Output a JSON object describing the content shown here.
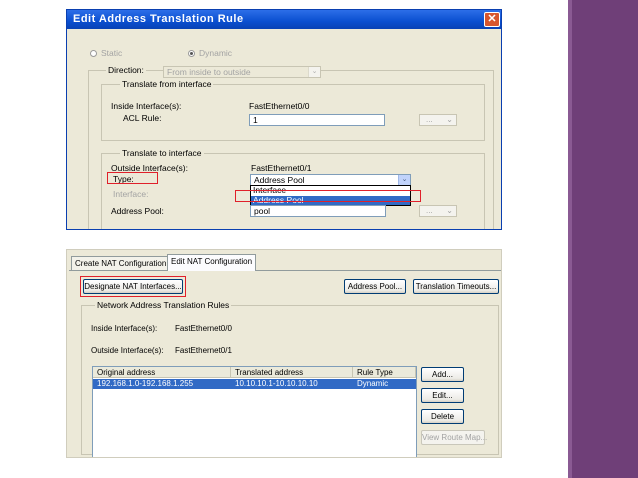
{
  "top_dialog": {
    "title": "Edit Address Translation Rule",
    "close_glyph": "✕",
    "mode": {
      "static_label": "Static",
      "dynamic_label": "Dynamic",
      "selected": "Dynamic"
    },
    "direction": {
      "label": "Direction:",
      "value": "From inside to outside"
    },
    "translate_from": {
      "legend": "Translate from interface",
      "inside_label": "Inside Interface(s):",
      "inside_value": "FastEthernet0/0",
      "acl_label": "ACL Rule:",
      "acl_value": "1",
      "acl_button": "..."
    },
    "translate_to": {
      "legend": "Translate to interface",
      "outside_label": "Outside Interface(s):",
      "outside_value": "FastEthernet0/1",
      "type_label": "Type:",
      "type_value": "Address Pool",
      "type_options": [
        "Interface",
        "Address Pool"
      ],
      "interface_label": "Interface:",
      "pool_label": "Address Pool:",
      "pool_value": "pool",
      "pool_button": "..."
    }
  },
  "bottom_window": {
    "tabs": [
      {
        "label": "Create NAT Configuration",
        "active": false
      },
      {
        "label": "Edit NAT Configuration",
        "active": true
      }
    ],
    "toolbar": {
      "designate_label": "Designate NAT Interfaces...",
      "address_pool_label": "Address Pool...",
      "timeouts_label": "Translation Timeouts..."
    },
    "rules": {
      "legend": "Network Address Translation Rules",
      "inside_label": "Inside Interface(s):",
      "inside_value": "FastEthernet0/0",
      "outside_label": "Outside Interface(s):",
      "outside_value": "FastEthernet0/1",
      "columns": [
        "Original address",
        "Translated address",
        "Rule Type"
      ],
      "rows": [
        {
          "original": "192.168.1.0-192.168.1.255",
          "translated": "10.10.10.1-10.10.10.10",
          "rule_type": "Dynamic"
        }
      ]
    },
    "side_buttons": {
      "add": "Add...",
      "edit": "Edit...",
      "delete": "Delete",
      "view": "View Route Map..."
    }
  },
  "colors": {
    "accent_purple": "#6f3f78",
    "titlebar_blue": "#0a4fd0",
    "highlight_red": "#e0202a",
    "selection_blue": "#316ac5"
  }
}
